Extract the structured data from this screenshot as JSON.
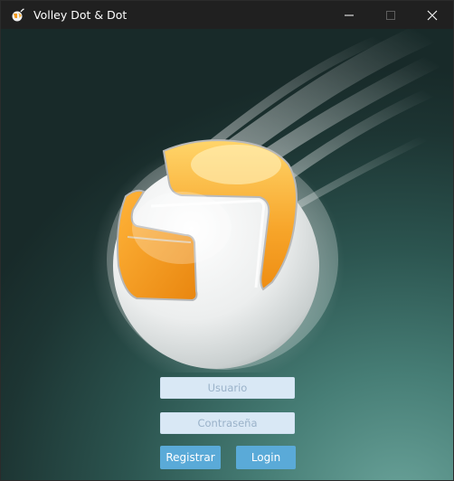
{
  "window": {
    "title": "Volley Dot & Dot"
  },
  "login_form": {
    "username_placeholder": "Usuario",
    "password_placeholder": "Contraseña",
    "register_label": "Registrar",
    "login_label": "Login"
  },
  "icons": {
    "app": "volleyball-icon",
    "minimize": "minimize-icon",
    "maximize": "maximize-icon",
    "close": "close-icon",
    "hero": "flaming-volleyball-logo"
  },
  "colors": {
    "button": "#5aaad8",
    "field": "#d9e8f5",
    "ball_orange": "#f39a1e",
    "ball_white": "#f2f3f3"
  }
}
